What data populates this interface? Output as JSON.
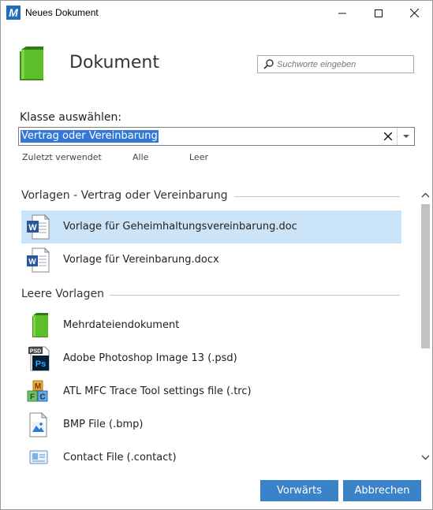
{
  "window": {
    "app_logo_letter": "M",
    "title": "Neues Dokument"
  },
  "header": {
    "title": "Dokument",
    "search_placeholder": "Suchworte eingeben"
  },
  "class_select": {
    "label": "Klasse auswählen:",
    "value": "Vertrag oder Vereinbarung"
  },
  "filters": [
    "Zuletzt verwendet",
    "Alle",
    "Leer"
  ],
  "groups": [
    {
      "title": "Vorlagen - Vertrag oder Vereinbarung",
      "items": [
        {
          "label": "Vorlage für Geheimhaltungsvereinbarung.doc",
          "icon": "word-doc-icon",
          "selected": true
        },
        {
          "label": "Vorlage für Vereinbarung.docx",
          "icon": "word-docx-icon",
          "selected": false
        }
      ]
    },
    {
      "title": "Leere Vorlagen",
      "items": [
        {
          "label": "Mehrdateiendokument",
          "icon": "green-book-icon",
          "selected": false
        },
        {
          "label": "Adobe Photoshop Image 13 (.psd)",
          "icon": "photoshop-icon",
          "selected": false
        },
        {
          "label": "ATL MFC Trace Tool settings file (.trc)",
          "icon": "mfc-blocks-icon",
          "selected": false
        },
        {
          "label": "BMP File (.bmp)",
          "icon": "bmp-image-icon",
          "selected": false
        },
        {
          "label": "Contact File (.contact)",
          "icon": "contact-card-icon",
          "selected": false
        }
      ]
    }
  ],
  "buttons": {
    "next": "Vorwärts",
    "cancel": "Abbrechen"
  },
  "colors": {
    "accent": "#3a83c9",
    "selection": "#cce4f7",
    "text_selection": "#3378d6",
    "book_green": "#5cbf2a"
  }
}
